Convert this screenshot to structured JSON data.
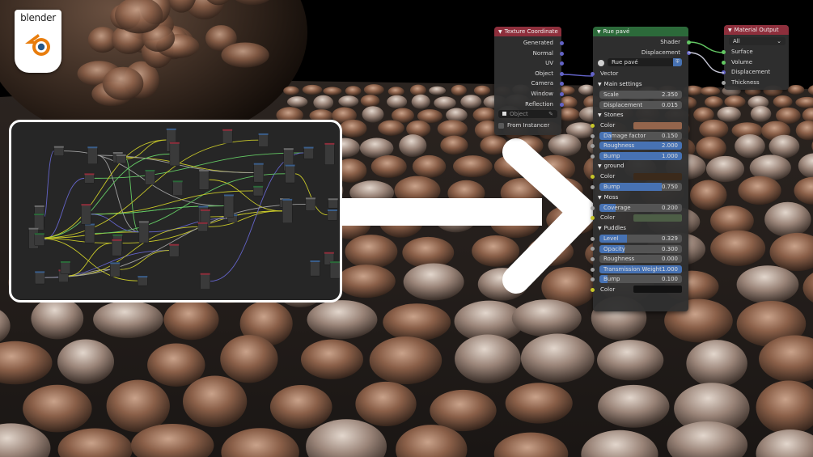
{
  "logo": {
    "text": "blender"
  },
  "texture_coordinate": {
    "title": "Texture Coordinate",
    "outputs": [
      "Generated",
      "Normal",
      "UV",
      "Object",
      "Camera",
      "Window",
      "Reflection"
    ],
    "object_placeholder": "Object",
    "from_instancer": "From Instancer"
  },
  "rue_pave": {
    "title": "Rue pavé",
    "shader": "Shader",
    "displacement": "Displacement",
    "group_name": "Rue pavé",
    "vector": "Vector",
    "main_settings": {
      "title": "Main settings",
      "scale_label": "Scale",
      "scale_value": "2.350",
      "displacement_label": "Displacement",
      "displacement_value": "0.015"
    },
    "stones": {
      "title": "Stones",
      "color_label": "Color",
      "color": "#94654c",
      "damage_label": "Damage factor",
      "damage_value": "0.150",
      "damage_fill": 0.15,
      "roughness_label": "Roughness",
      "roughness_value": "2.000",
      "bump_label": "Bump",
      "bump_value": "1.000"
    },
    "ground": {
      "title": "ground",
      "color_label": "Color",
      "color": "#3b2a1b",
      "bump_label": "Bump",
      "bump_value": "0.750",
      "bump_fill": 0.75
    },
    "moss": {
      "title": "Moss",
      "coverage_label": "Coverage",
      "coverage_value": "0.200",
      "coverage_fill": 0.2,
      "color_label": "Color",
      "color": "#4d5e46"
    },
    "puddles": {
      "title": "Puddles",
      "level_label": "Level",
      "level_value": "0.329",
      "level_fill": 0.329,
      "opacity_label": "Opacity",
      "opacity_value": "0.300",
      "opacity_fill": 0.3,
      "roughness_label": "Roughness",
      "roughness_value": "0.000",
      "transmission_label": "Transmission Weight",
      "transmission_value": "1.000",
      "bump_label": "Bump",
      "bump_value": "0.100",
      "bump_fill": 0.1,
      "color_label": "Color",
      "color": "#121212"
    }
  },
  "material_output": {
    "title": "Material Output",
    "target": "All",
    "inputs": [
      "Surface",
      "Volume",
      "Displacement",
      "Thickness"
    ]
  },
  "colors": {
    "node_bg": "#303030",
    "header_red": "#8e2f3c",
    "header_green": "#2c6a3a",
    "field_blue": "#4772b3",
    "socket_purple": "#6363c7",
    "socket_green": "#63c763",
    "socket_yellow": "#c7c729",
    "socket_grey": "#a1a1a1",
    "logo_orange": "#e87d0d",
    "logo_blue": "#265787"
  }
}
